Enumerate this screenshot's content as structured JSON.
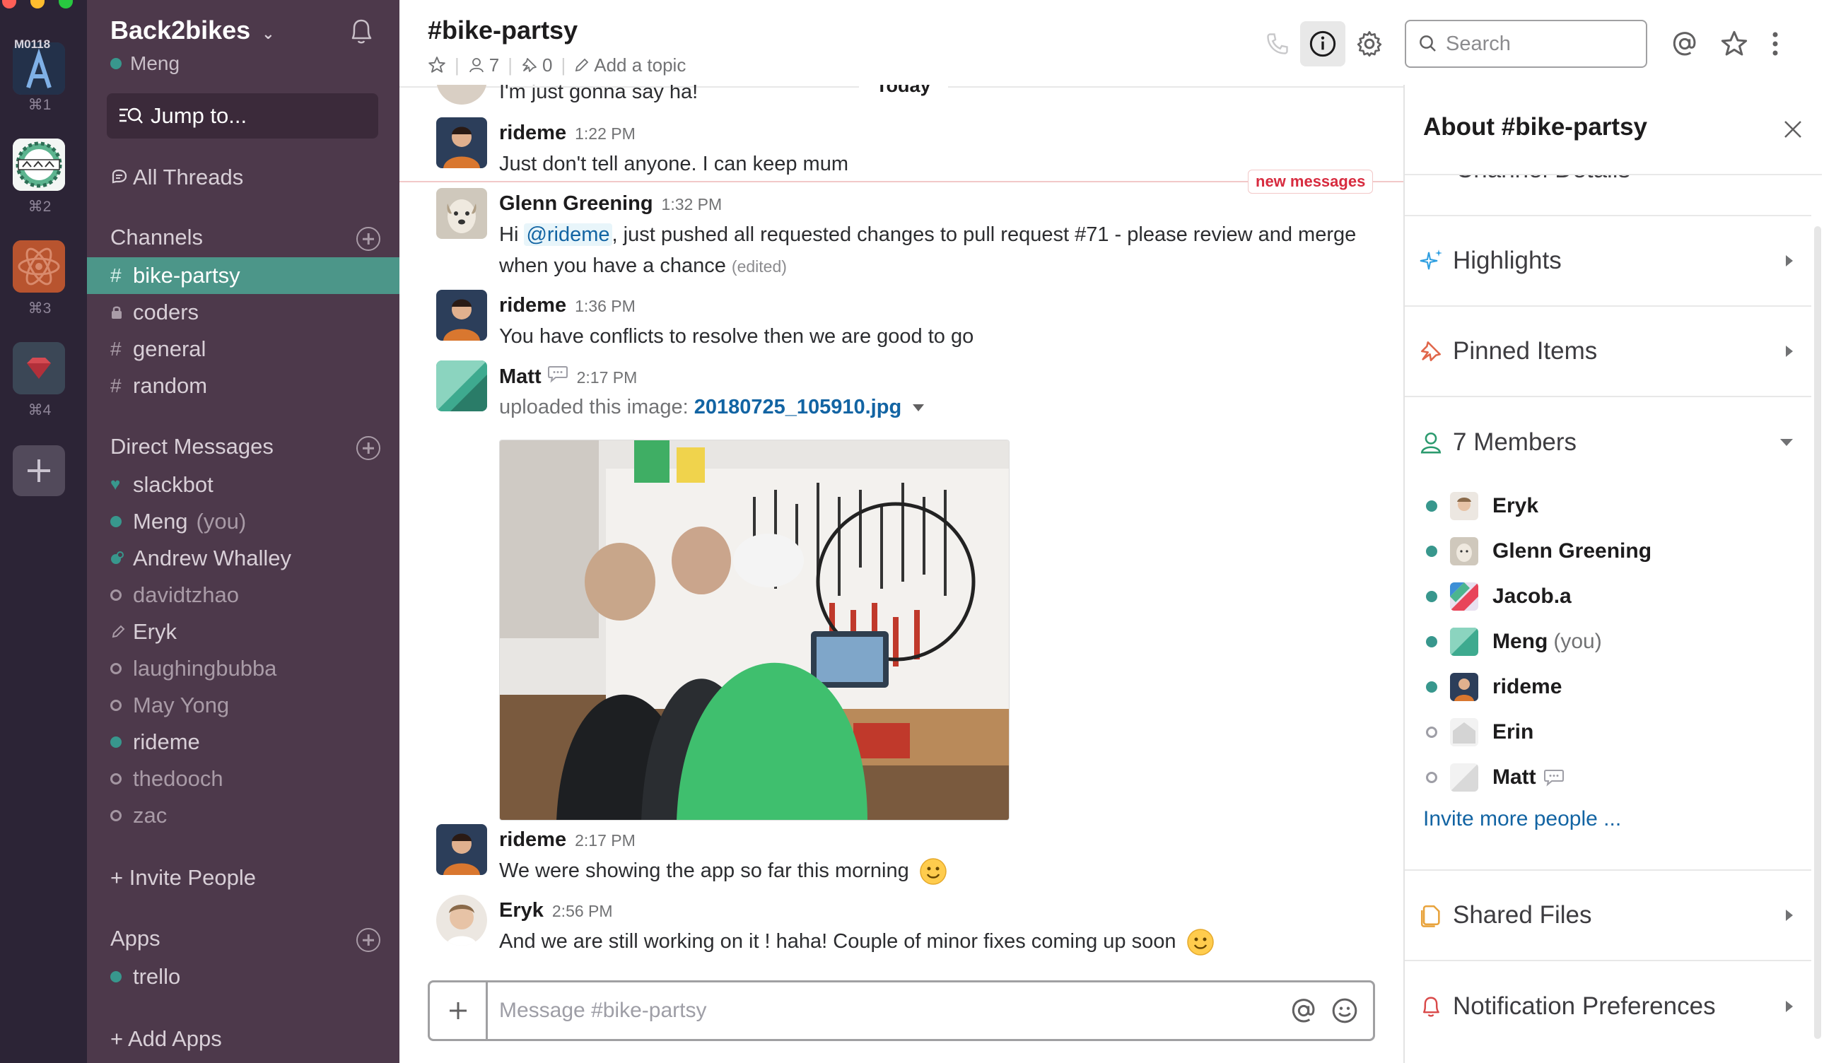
{
  "teams": {
    "items": [
      {
        "tag": "M0118",
        "shortcut": "⌘1"
      },
      {
        "shortcut": "⌘2"
      },
      {
        "shortcut": "⌘3"
      },
      {
        "shortcut": "⌘4"
      }
    ]
  },
  "sidebar": {
    "workspace": "Back2bikes",
    "user": "Meng",
    "jump": "Jump to...",
    "all_threads": "All Threads",
    "channels_header": "Channels",
    "channels": [
      {
        "prefix": "#",
        "name": "bike-partsy"
      },
      {
        "prefix": "lock",
        "name": "coders"
      },
      {
        "prefix": "#",
        "name": "general"
      },
      {
        "prefix": "#",
        "name": "random"
      }
    ],
    "dm_header": "Direct Messages",
    "dms": [
      {
        "name": "slackbot",
        "status": "heart"
      },
      {
        "name": "Meng",
        "suffix": "(you)",
        "status": "online"
      },
      {
        "name": "Andrew Whalley",
        "status": "online"
      },
      {
        "name": "davidtzhao",
        "status": "offline"
      },
      {
        "name": "Eryk",
        "status": "pencil"
      },
      {
        "name": "laughingbubba",
        "status": "offline"
      },
      {
        "name": "May Yong",
        "status": "offline"
      },
      {
        "name": "rideme",
        "status": "online"
      },
      {
        "name": "thedooch",
        "status": "offline"
      },
      {
        "name": "zac",
        "status": "offline"
      }
    ],
    "invite": "+ Invite People",
    "apps_header": "Apps",
    "apps": [
      {
        "name": "trello",
        "status": "online"
      }
    ],
    "add_apps": "+ Add Apps"
  },
  "header": {
    "channel": "#bike-partsy",
    "members_count": "7",
    "pins_count": "0",
    "add_topic": "Add a topic",
    "search_placeholder": "Search"
  },
  "messages": {
    "today_label": "Today",
    "new_messages_label": "new messages",
    "partial_text": "I'm just gonna say ha!",
    "items": [
      {
        "author": "rideme",
        "time": "1:22 PM",
        "text": "Just don't tell anyone. I can keep mum"
      },
      {
        "author": "Glenn Greening",
        "time": "1:32 PM",
        "pre": "Hi ",
        "mention": "@rideme",
        "text": ", just pushed all requested changes to pull request #71 - please review and merge when you have a chance",
        "edited": "(edited)"
      },
      {
        "author": "rideme",
        "time": "1:36 PM",
        "text": "You have conflicts to resolve then we are good to go"
      },
      {
        "author": "Matt",
        "time": "2:17 PM",
        "text": "uploaded this image:",
        "file": "20180725_105910.jpg"
      },
      {
        "author": "rideme",
        "time": "2:17 PM",
        "text": "We were showing the app so far this morning"
      },
      {
        "author": "Eryk",
        "time": "2:56 PM",
        "text": "And we are still working on it ! haha! Couple of minor fixes coming up soon"
      }
    ]
  },
  "composer": {
    "placeholder": "Message #bike-partsy"
  },
  "panel": {
    "title": "About #bike-partsy",
    "partial_section": "Channel Details",
    "sections": [
      "Highlights",
      "Pinned Items",
      "7 Members",
      "Shared Files",
      "Notification Preferences"
    ],
    "members": [
      {
        "name": "Eryk",
        "status": "online"
      },
      {
        "name": "Glenn Greening",
        "status": "online"
      },
      {
        "name": "Jacob.a",
        "status": "online"
      },
      {
        "name": "Meng",
        "suffix": "(you)",
        "status": "online"
      },
      {
        "name": "rideme",
        "status": "online"
      },
      {
        "name": "Erin",
        "status": "offline"
      },
      {
        "name": "Matt",
        "status": "offline"
      }
    ],
    "invite": "Invite more people ..."
  },
  "colors": {
    "sidebar": "#4d394b",
    "team_bar": "#2c2436",
    "active_channel": "#4c9689",
    "online": "#38978d",
    "link": "#1264a3",
    "new_messages": "#d72b3f"
  }
}
